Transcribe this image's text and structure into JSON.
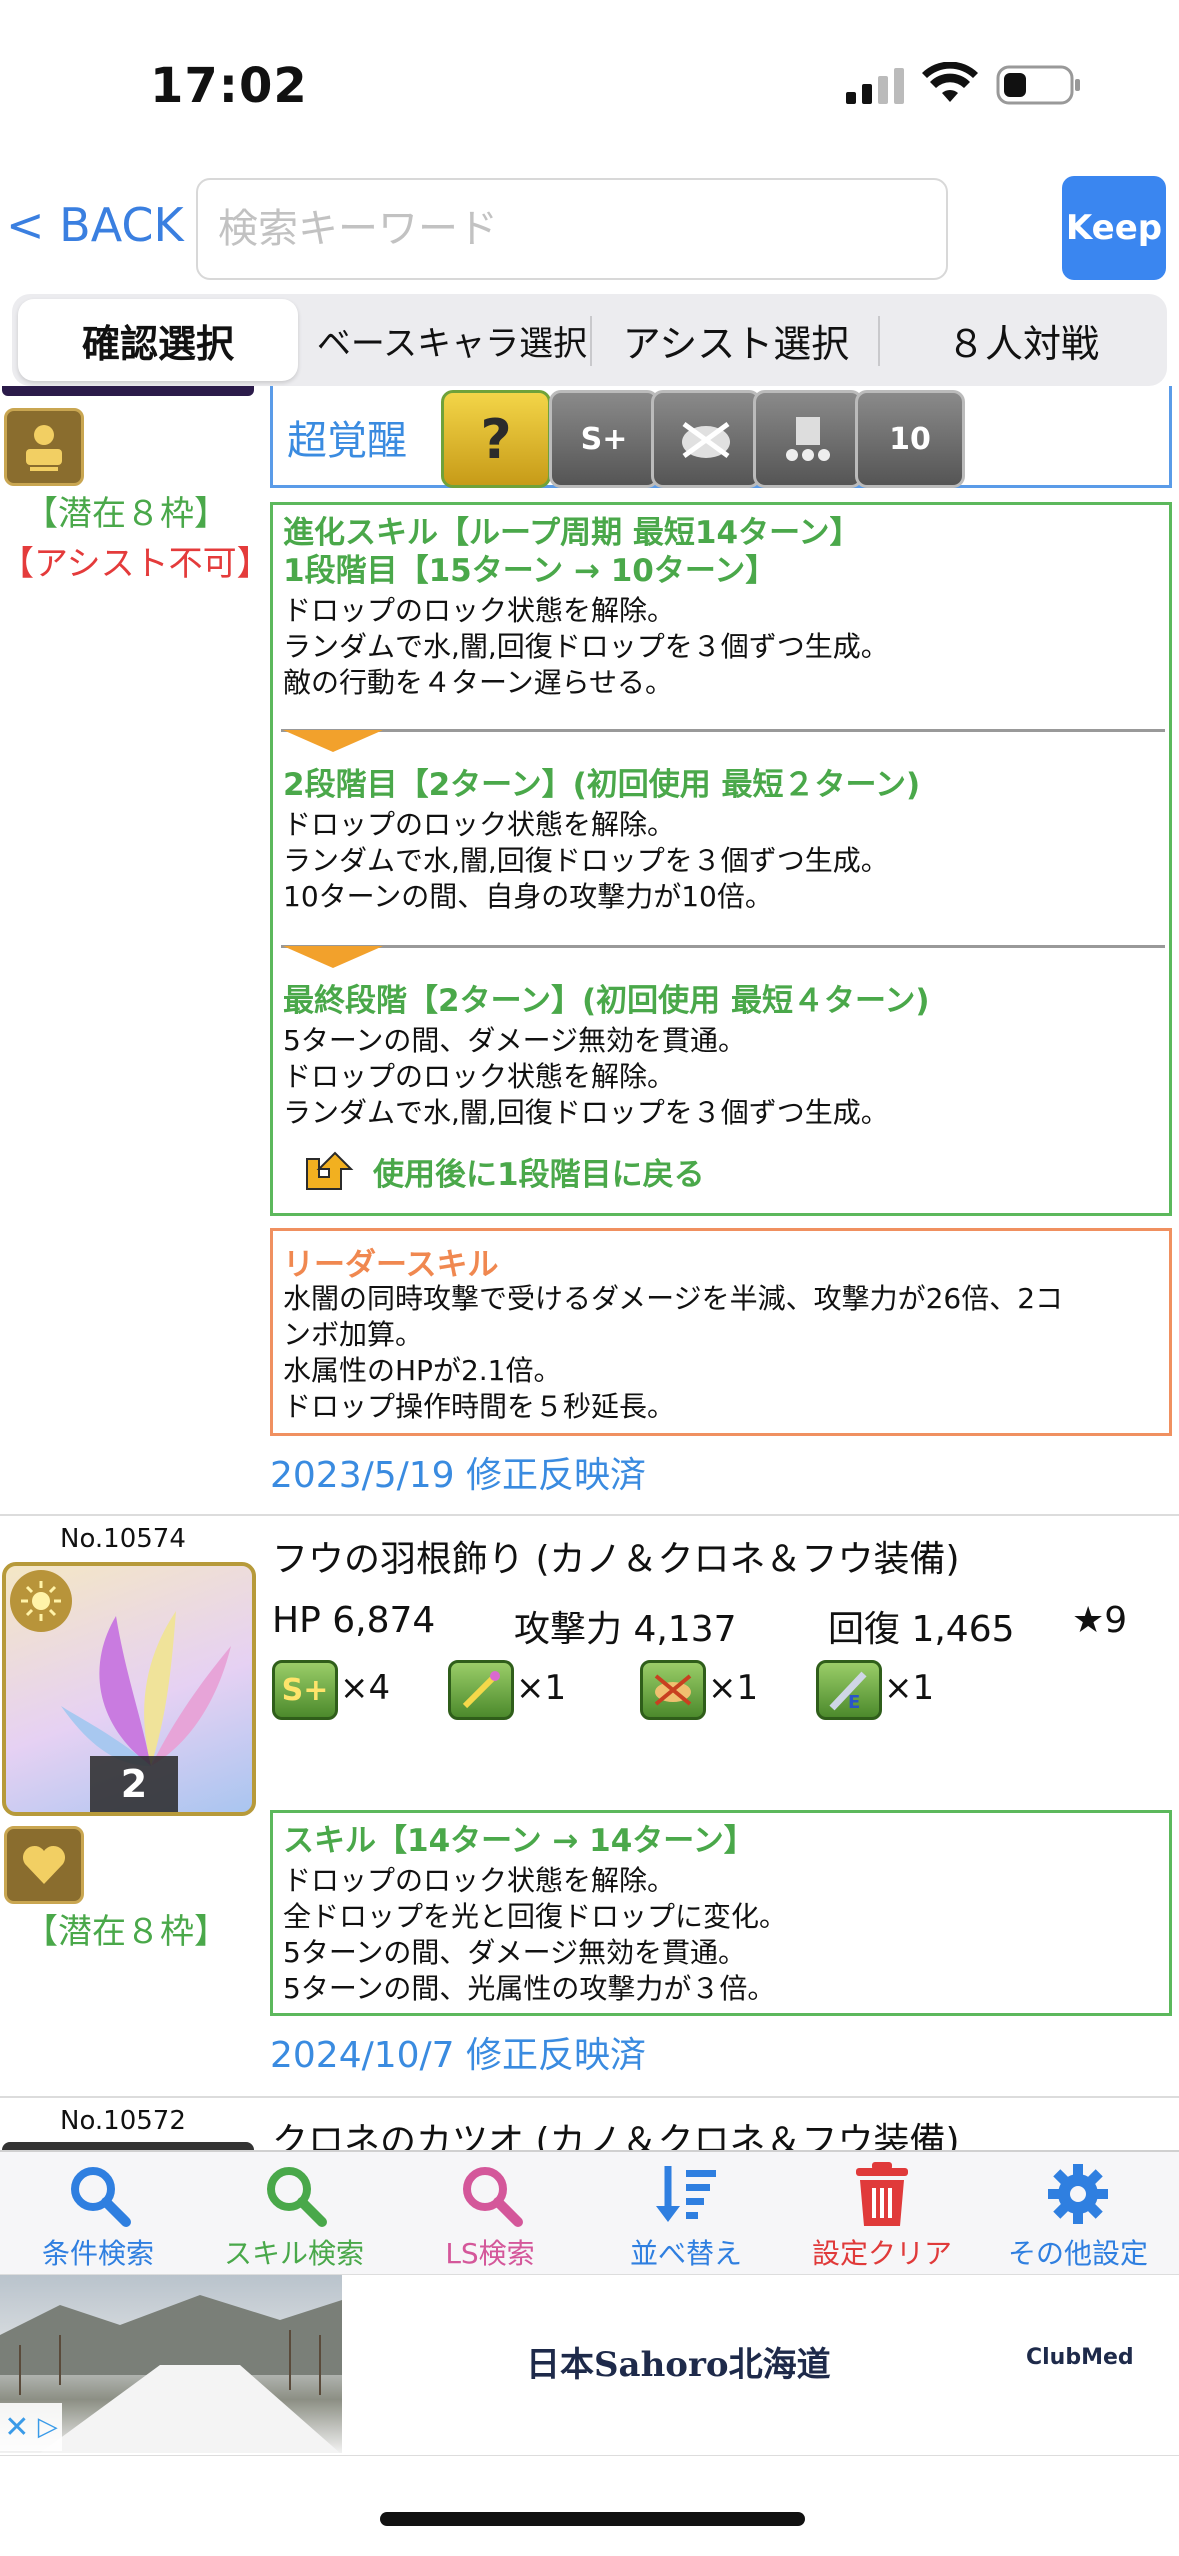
{
  "status_bar": {
    "time": "17:02"
  },
  "header": {
    "back_label": "< BACK",
    "search_placeholder": "検索キーワード",
    "keep_label": "Keep"
  },
  "tabs": [
    {
      "label": "確認選択",
      "active": true
    },
    {
      "label": "ベースキャラ選択",
      "active": false
    },
    {
      "label": "アシスト選択",
      "active": false
    },
    {
      "label": "８人対戦",
      "active": false
    }
  ],
  "card1": {
    "latent_label": "【潜在８枠】",
    "assist_label": "【アシスト不可】",
    "super_awakening_label": "超覚醒",
    "super_awakening_icons": [
      "question-awakening-icon",
      "skill-boost-plus-icon",
      "poison-resist-icon",
      "board-change-icon",
      "ten-combo-icon"
    ],
    "super_awakening_glyphs": [
      "?",
      "S+",
      "",
      "",
      "10"
    ],
    "evolve_skill": {
      "title": "進化スキル【ループ周期 最短14ターン】",
      "stages": [
        {
          "header": "1段階目【15ターン → 10ターン】",
          "lines": [
            "ドロップのロック状態を解除。",
            "ランダムで水,闇,回復ドロップを３個ずつ生成。",
            "敵の行動を４ターン遅らせる。"
          ]
        },
        {
          "header": "2段階目【2ターン】(初回使用 最短２ターン)",
          "lines": [
            "ドロップのロック状態を解除。",
            "ランダムで水,闇,回復ドロップを３個ずつ生成。",
            "10ターンの間、自身の攻撃力が10倍。"
          ]
        },
        {
          "header": "最終段階【2ターン】(初回使用 最短４ターン)",
          "lines": [
            "5ターンの間、ダメージ無効を貫通。",
            "ドロップのロック状態を解除。",
            "ランダムで水,闇,回復ドロップを３個ずつ生成。"
          ]
        }
      ],
      "loop_note": "使用後に1段階目に戻る"
    },
    "leader_skill": {
      "title": "リーダースキル",
      "lines": [
        "水闇の同時攻撃で受けるダメージを半減、攻撃力が26倍、2コ",
        "ンボ加算。",
        "水属性のHPが2.1倍。",
        "ドロップ操作時間を５秒延長。"
      ]
    },
    "revision": "2023/5/19 修正反映済"
  },
  "card2": {
    "number": "No.10574",
    "name": "フウの羽根飾り (カノ＆クロネ＆フウ装備)",
    "hp": "HP 6,874",
    "atk": "攻撃力 4,137",
    "rcv": "回復 1,465",
    "rarity": "★9",
    "level_badge": "2",
    "awakenings": [
      {
        "icon": "skill-boost-icon",
        "count": "×4"
      },
      {
        "icon": "skill-charge-icon",
        "count": "×1"
      },
      {
        "icon": "cloud-resist-icon",
        "count": "×1"
      },
      {
        "icon": "sword-e-icon",
        "count": "×1"
      }
    ],
    "latent_label": "【潜在８枠】",
    "skill": {
      "title": "スキル【14ターン → 14ターン】",
      "lines": [
        "ドロップのロック状態を解除。",
        "全ドロップを光と回復ドロップに変化。",
        "5ターンの間、ダメージ無効を貫通。",
        "5ターンの間、光属性の攻撃力が３倍。"
      ]
    },
    "revision": "2024/10/7 修正反映済"
  },
  "card3": {
    "number": "No.10572",
    "name": "クロネのカツオ (カノ＆クロネ＆フウ装備)"
  },
  "navbar": [
    {
      "label": "条件検索",
      "color": "#2f7fe0",
      "icon": "search-icon"
    },
    {
      "label": "スキル検索",
      "color": "#49a84a",
      "icon": "search-icon"
    },
    {
      "label": "LS検索",
      "color": "#d4579a",
      "icon": "search-icon"
    },
    {
      "label": "並べ替え",
      "color": "#2f7fe0",
      "icon": "sort-icon"
    },
    {
      "label": "設定クリア",
      "color": "#e03a3a",
      "icon": "trash-icon"
    },
    {
      "label": "その他設定",
      "color": "#2f7fe0",
      "icon": "gear-icon"
    }
  ],
  "ad": {
    "title": "日本Sahoro北海道",
    "brand": "ClubMed"
  }
}
